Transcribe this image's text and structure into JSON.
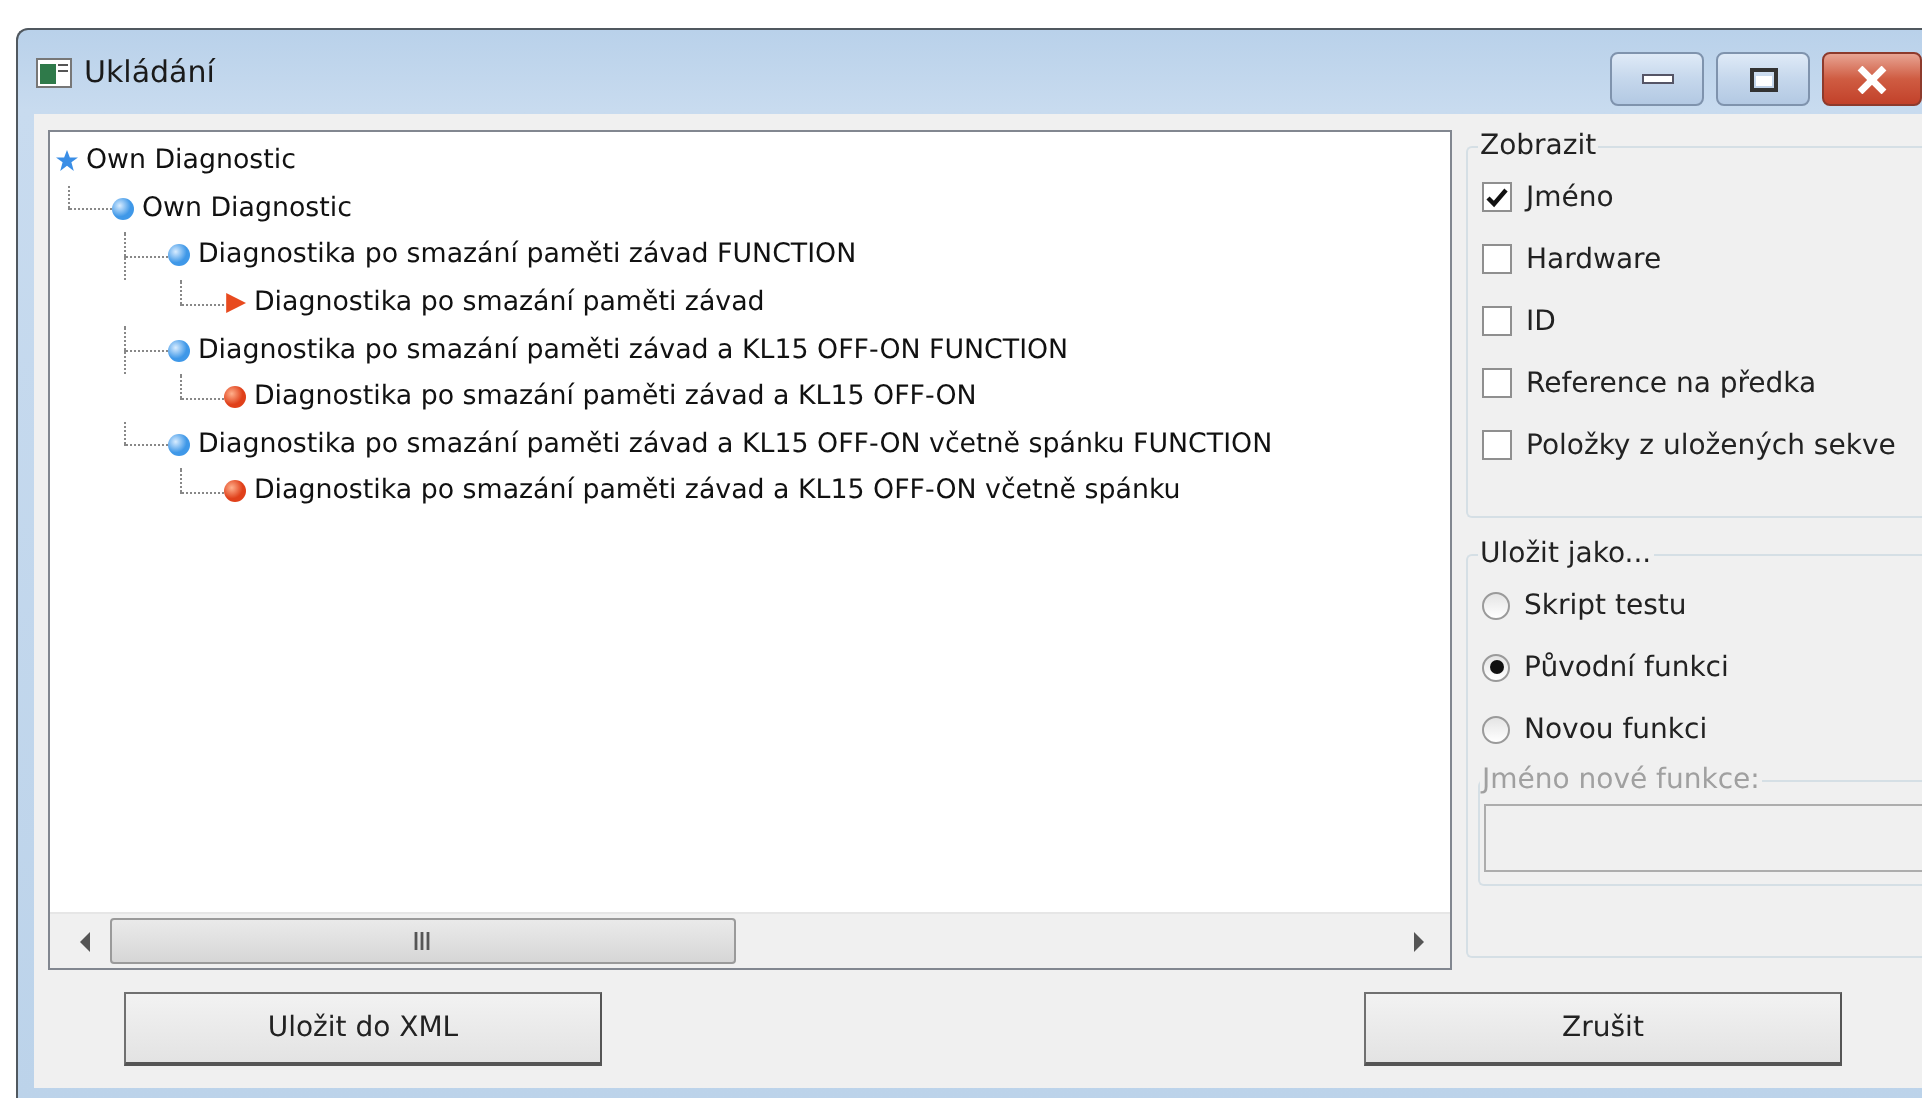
{
  "window": {
    "title": "Ukládání"
  },
  "tree": [
    {
      "label": "Own Diagnostic",
      "kind": "root",
      "children": [
        {
          "label": "Own Diagnostic",
          "kind": "group",
          "children": [
            {
              "label": "Diagnostika po smazání paměti závad FUNCTION",
              "kind": "group",
              "children": [
                {
                  "label": "Diagnostika po smazání paměti závad",
                  "kind": "script"
                }
              ]
            },
            {
              "label": "Diagnostika po smazání paměti závad a KL15 OFF-ON FUNCTION",
              "kind": "group",
              "children": [
                {
                  "label": "Diagnostika po smazání paměti závad a KL15 OFF-ON",
                  "kind": "item"
                }
              ]
            },
            {
              "label": "Diagnostika po smazání paměti závad a KL15 OFF-ON včetně spánku FUNCTION",
              "kind": "group",
              "children": [
                {
                  "label": "Diagnostika po smazání paměti závad a KL15 OFF-ON včetně spánku",
                  "kind": "item"
                }
              ]
            }
          ]
        }
      ]
    }
  ],
  "display_group": {
    "title": "Zobrazit",
    "options": [
      {
        "label": "Jméno",
        "checked": true
      },
      {
        "label": "Hardware",
        "checked": false
      },
      {
        "label": "ID",
        "checked": false
      },
      {
        "label": "Reference na předka",
        "checked": false
      },
      {
        "label": "Položky z uložených sekve",
        "checked": false
      }
    ]
  },
  "save_as_group": {
    "title": "Uložit jako...",
    "options": [
      {
        "label": "Skript testu",
        "selected": false
      },
      {
        "label": "Původní funkci",
        "selected": true
      },
      {
        "label": "Novou funkci",
        "selected": false
      }
    ],
    "new_function": {
      "title": "Jméno nové funkce:",
      "disabled": true
    }
  },
  "buttons": [
    {
      "label": "Uložit do XML"
    },
    {
      "label": "Zrušit"
    }
  ]
}
